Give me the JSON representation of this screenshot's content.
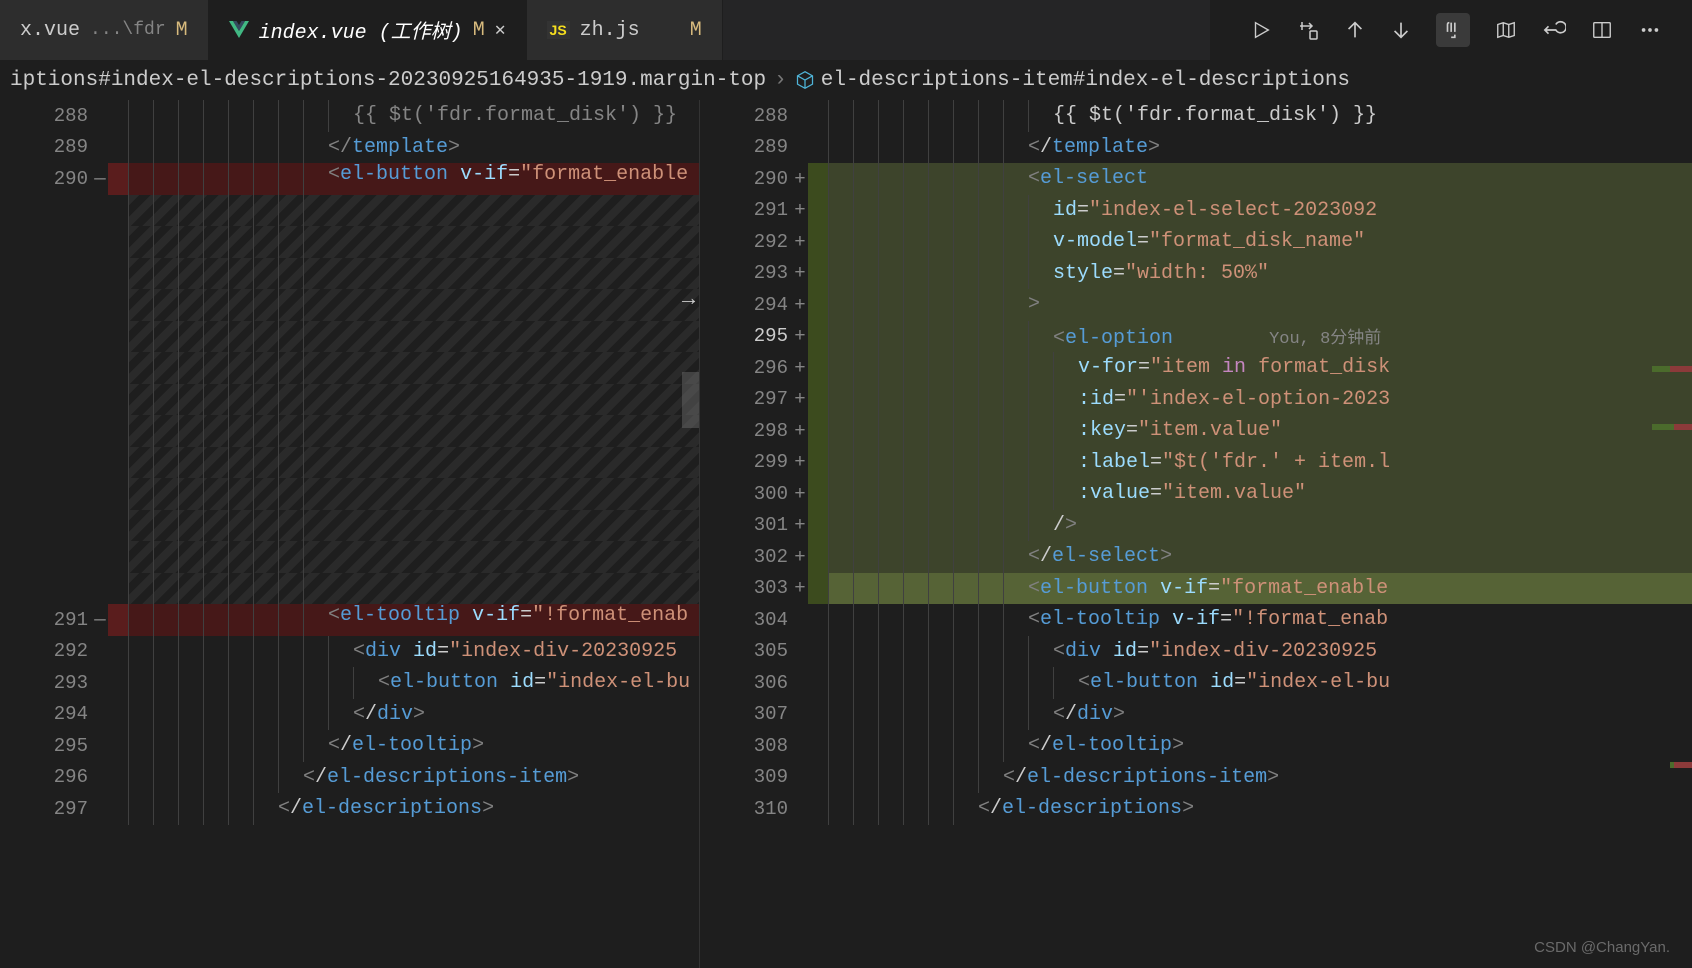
{
  "tabs": [
    {
      "name": "x.vue",
      "path": "...\\fdr",
      "status": "M"
    },
    {
      "name": "index.vue (工作树)",
      "status": "M",
      "active": true
    },
    {
      "name": "zh.js",
      "status": "M"
    }
  ],
  "breadcrumb": {
    "part1": "iptions#index-el-descriptions-20230925164935-1919.margin-top",
    "part2": "el-descriptions-item#index-el-descriptions"
  },
  "left": {
    "lines": [
      {
        "n": "288",
        "indent": 9,
        "html": "{{ $t('fdr.format_disk') }}"
      },
      {
        "n": "289",
        "indent": 8,
        "html": "</<t>template</t>>"
      },
      {
        "n": "290",
        "m": "—",
        "removed": true,
        "indent": 8,
        "html": "<<t>el-button</t> <a>v-if</a>=<s>\"format_enable</s>"
      },
      {
        "n": "291",
        "m": "—",
        "removed": true,
        "indent": 8,
        "html": "<<t>el-tooltip</t> <a>v-if</a>=<s>\"!format_enab</s>"
      },
      {
        "n": "292",
        "indent": 9,
        "html": "<<t>div</t> <a>id</a>=<s>\"index-div-20230925</s>"
      },
      {
        "n": "293",
        "indent": 10,
        "html": "<<t>el-button</t> <a>id</a>=<s>\"index-el-bu</s>"
      },
      {
        "n": "294",
        "indent": 9,
        "html": "</<t>div</t>>"
      },
      {
        "n": "295",
        "indent": 8,
        "html": "</<t>el-tooltip</t>>"
      },
      {
        "n": "296",
        "indent": 7,
        "html": "</<t>el-descriptions-item</t>>"
      },
      {
        "n": "297",
        "indent": 6,
        "html": "</<t>el-descriptions</t>>"
      }
    ]
  },
  "right": {
    "lines": [
      {
        "n": "288",
        "indent": 9,
        "html": "{{ $t('fdr.format_disk') }}"
      },
      {
        "n": "289",
        "indent": 8,
        "html": "</<t>template</t>>"
      },
      {
        "n": "290",
        "m": "+",
        "added": true,
        "indent": 8,
        "html": "<<t>el-select</t>"
      },
      {
        "n": "291",
        "m": "+",
        "added": true,
        "indent": 9,
        "html": "<a>id</a>=<s>\"index-el-select-2023092</s>"
      },
      {
        "n": "292",
        "m": "+",
        "added": true,
        "indent": 9,
        "html": "<a>v-model</a>=<s>\"format_disk_name\"</s>"
      },
      {
        "n": "293",
        "m": "+",
        "added": true,
        "indent": 9,
        "html": "<a>style</a>=<s>\"width: 50%\"</s>"
      },
      {
        "n": "294",
        "m": "+",
        "added": true,
        "indent": 8,
        "html": ">"
      },
      {
        "n": "295",
        "m": "+",
        "added": true,
        "cur": true,
        "indent": 9,
        "html": "<<t>el-option</t>        <lens>You, 8分钟前</lens>"
      },
      {
        "n": "296",
        "m": "+",
        "added": true,
        "indent": 10,
        "html": "<a>v-for</a>=<s>\"item </s><k>in</k><s> format_disk</s>"
      },
      {
        "n": "297",
        "m": "+",
        "added": true,
        "indent": 10,
        "html": "<a>:id</a>=<s>\"'index-el-option-2023</s>"
      },
      {
        "n": "298",
        "m": "+",
        "added": true,
        "indent": 10,
        "html": "<a>:key</a>=<s>\"item.value\"</s>"
      },
      {
        "n": "299",
        "m": "+",
        "added": true,
        "indent": 10,
        "html": "<a>:label</a>=<s>\"$t('fdr.' + item.l</s>"
      },
      {
        "n": "300",
        "m": "+",
        "added": true,
        "indent": 10,
        "html": "<a>:value</a>=<s>\"item.value\"</s>"
      },
      {
        "n": "301",
        "m": "+",
        "added": true,
        "indent": 9,
        "html": "/>"
      },
      {
        "n": "302",
        "m": "+",
        "added": true,
        "indent": 8,
        "html": "</<t>el-select</t>>"
      },
      {
        "n": "303",
        "m": "+",
        "added": true,
        "strong": true,
        "indent": 8,
        "html": "<<t>el-button</t> <a>v-if</a>=<s>\"format_enable</s>"
      },
      {
        "n": "304",
        "indent": 8,
        "html": "<<t>el-tooltip</t> <a>v-if</a>=<s>\"!format_enab</s>"
      },
      {
        "n": "305",
        "indent": 9,
        "html": "<<t>div</t> <a>id</a>=<s>\"index-div-20230925</s>"
      },
      {
        "n": "306",
        "indent": 10,
        "html": "<<t>el-button</t> <a>id</a>=<s>\"index-el-bu</s>"
      },
      {
        "n": "307",
        "indent": 9,
        "html": "</<t>div</t>>"
      },
      {
        "n": "308",
        "indent": 8,
        "html": "</<t>el-tooltip</t>>"
      },
      {
        "n": "309",
        "indent": 7,
        "html": "</<t>el-descriptions-item</t>>"
      },
      {
        "n": "310",
        "indent": 6,
        "html": "</<t>el-descriptions</t>>"
      }
    ]
  },
  "watermark": "CSDN @ChangYan."
}
